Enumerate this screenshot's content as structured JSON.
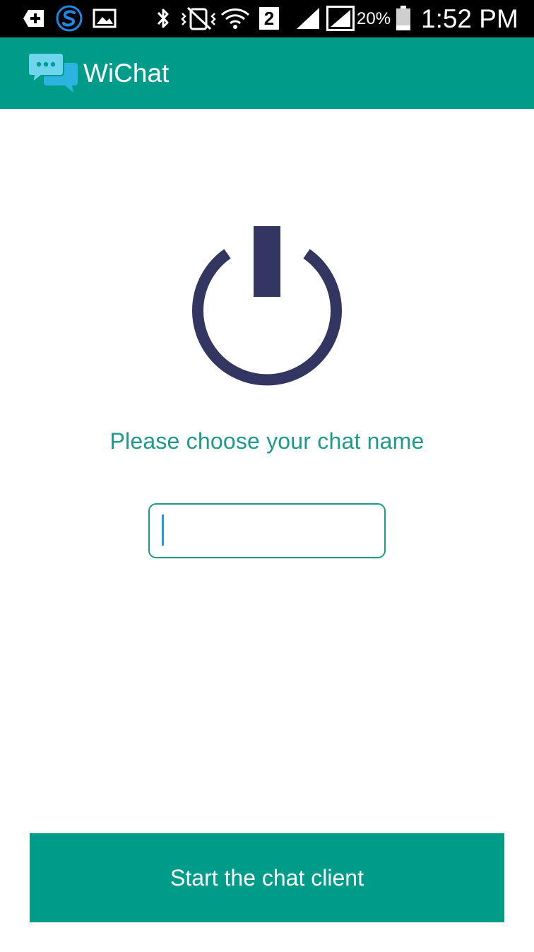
{
  "status_bar": {
    "network_badge": "2",
    "battery_percent": "20%",
    "time": "1:52 PM",
    "icons": [
      "add-notification-icon",
      "s-app-icon",
      "image-icon",
      "bluetooth-icon",
      "vibrate-icon",
      "wifi-icon",
      "sim-2-icon",
      "signal-icon",
      "signal-r-icon",
      "battery-icon"
    ]
  },
  "app_bar": {
    "title": "WiChat",
    "logo_icon": "chat-bubbles-icon",
    "background": "#009c8a"
  },
  "main": {
    "power_icon": "power-icon",
    "prompt": "Please choose your chat name",
    "name_input": {
      "value": "",
      "placeholder": ""
    },
    "start_button_label": "Start the chat client"
  },
  "colors": {
    "accent": "#009c8a",
    "text_accent": "#1d9a88",
    "power_icon": "#333660",
    "caret": "#1e9be8"
  }
}
